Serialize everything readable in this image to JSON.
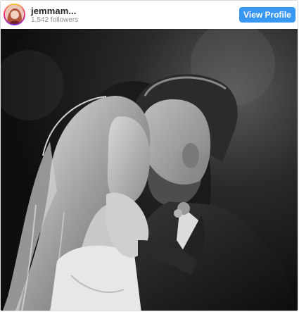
{
  "header": {
    "username": "jemmam...",
    "followers": "1,542 followers",
    "view_profile_label": "View Profile"
  },
  "post": {
    "image": "black-and-white-wedding-kiss-photo",
    "colors": {
      "button": "#3897f0",
      "followers_text": "#8e8e8e",
      "username_text": "#262626"
    }
  }
}
